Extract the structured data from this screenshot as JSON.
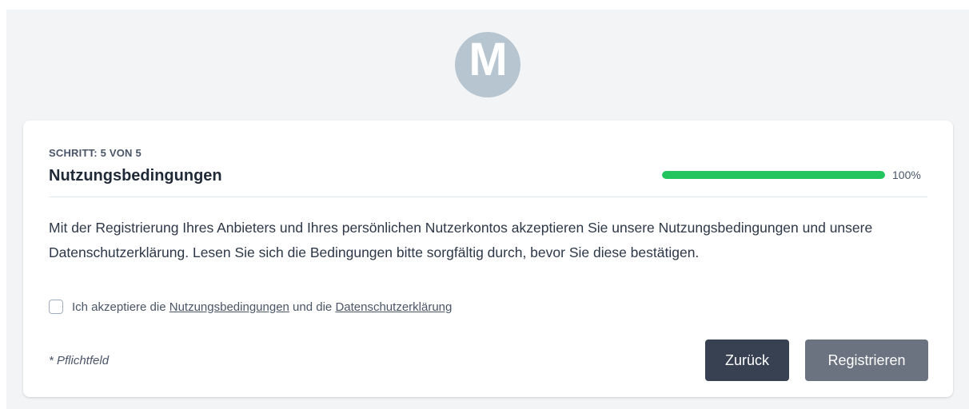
{
  "logo": {
    "letter": "M",
    "color": "#b6c5cf"
  },
  "step": {
    "label": "SCHRITT: 5 VON 5",
    "title": "Nutzungsbedingungen"
  },
  "progress": {
    "value": 1.0,
    "text": "100%",
    "color": "#22c55e"
  },
  "content": {
    "text": "Mit der Registrierung Ihres Anbieters und Ihres persönlichen Nutzerkontos akzeptieren Sie unsere Nutzungsbedingungen und unsere Datenschutzerklärung. Lesen Sie sich die Bedingungen bitte sorgfältig durch, bevor Sie diese bestätigen."
  },
  "accept": {
    "checked": false,
    "prefix": "Ich akzeptiere die",
    "terms_link": "Nutzungsbedingungen",
    "middle": "und die",
    "privacy_link": "Datenschutzerklärung"
  },
  "footer": {
    "required_note": "* Pflichtfeld",
    "back_label": "Zurück",
    "register_label": "Registrieren"
  }
}
